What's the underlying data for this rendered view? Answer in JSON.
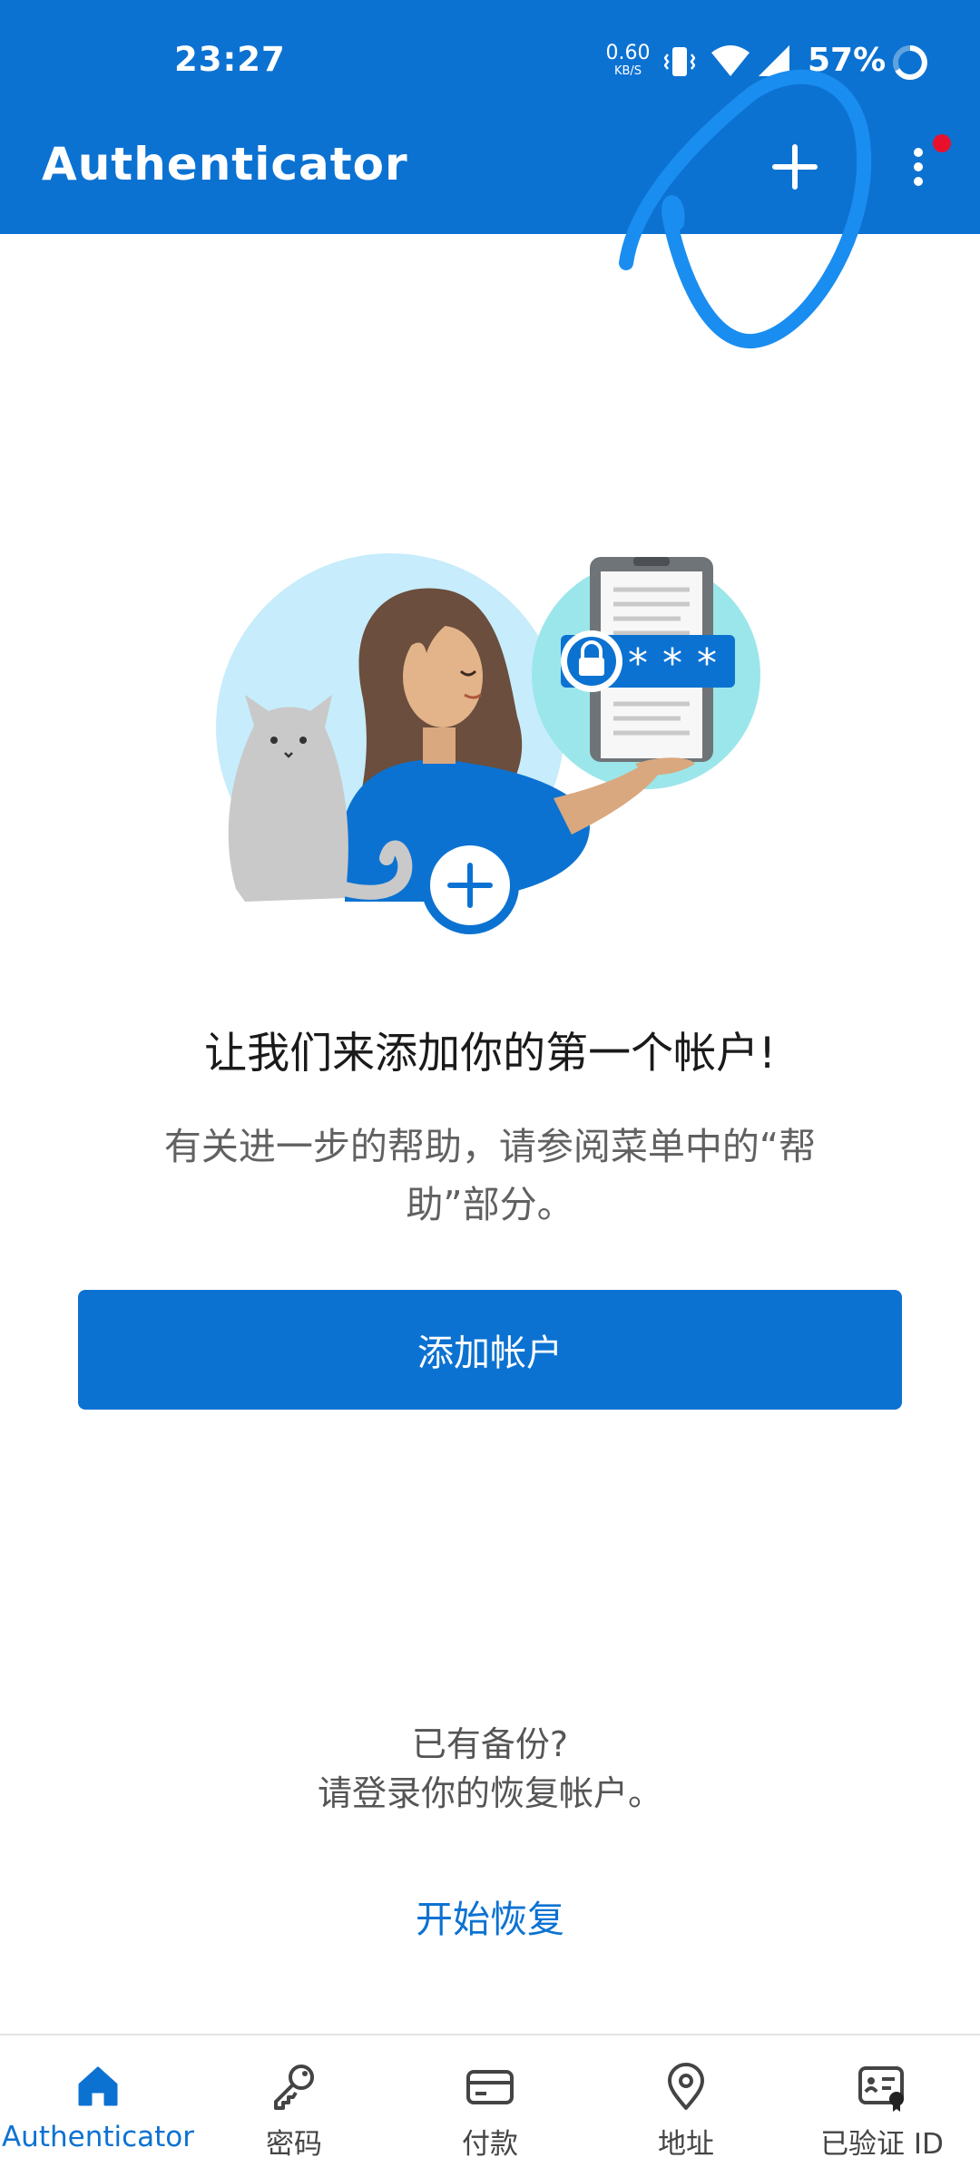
{
  "status_bar": {
    "time": "23:27",
    "net_speed_value": "0.60",
    "net_speed_unit": "KB/S",
    "battery_percent": "57%"
  },
  "header": {
    "title": "Authenticator"
  },
  "main": {
    "headline": "让我们来添加你的第一个帐户!",
    "help_text": "有关进一步的帮助，请参阅菜单中的“帮助”部分。",
    "add_account_label": "添加帐户",
    "backup_question": "已有备份?",
    "backup_prompt": "请登录你的恢复帐户。",
    "start_recovery_label": "开始恢复"
  },
  "bottom_nav": {
    "items": [
      {
        "label": "Authenticator",
        "icon": "home-icon",
        "active": true
      },
      {
        "label": "密码",
        "icon": "key-icon",
        "active": false
      },
      {
        "label": "付款",
        "icon": "card-icon",
        "active": false
      },
      {
        "label": "地址",
        "icon": "location-pin-icon",
        "active": false
      },
      {
        "label": "已验证 ID",
        "icon": "id-card-icon",
        "active": false
      }
    ]
  },
  "colors": {
    "brand": "#0c72d2",
    "notification": "#e8112d"
  }
}
